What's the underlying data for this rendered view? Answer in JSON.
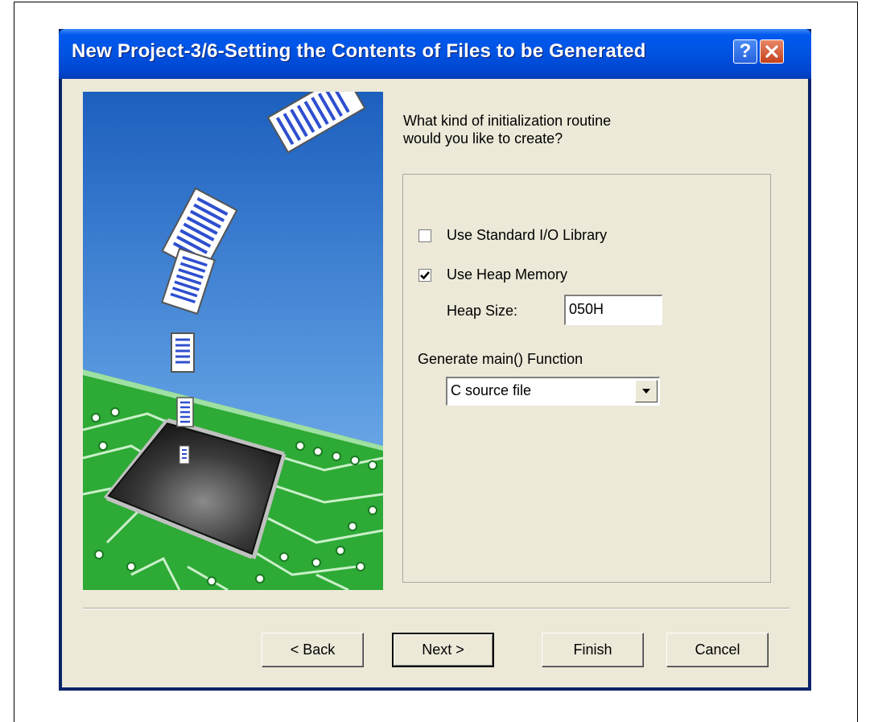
{
  "dialog": {
    "title": "New Project-3/6-Setting the Contents of Files to be Generated",
    "help_glyph": "?",
    "close_icon": "close-x-icon"
  },
  "prompt": {
    "line1": "What kind of initialization routine",
    "line2": "would you like to create?"
  },
  "options": {
    "std_io": {
      "label": "Use Standard I/O Library",
      "checked": false
    },
    "heap": {
      "label": "Use Heap Memory",
      "checked": true
    },
    "heap_size_label": "Heap Size:",
    "heap_size_value": "050H",
    "main_label": "Generate main() Function",
    "main_selected": "C source file"
  },
  "buttons": {
    "back": "< Back",
    "next": "Next >",
    "finish": "Finish",
    "cancel": "Cancel"
  },
  "colors": {
    "titlebar": "#0054e3",
    "dialog_bg": "#ece9d8",
    "close": "#c4401b",
    "pcb": "#2eaa36",
    "sky": "#3f82d6"
  }
}
